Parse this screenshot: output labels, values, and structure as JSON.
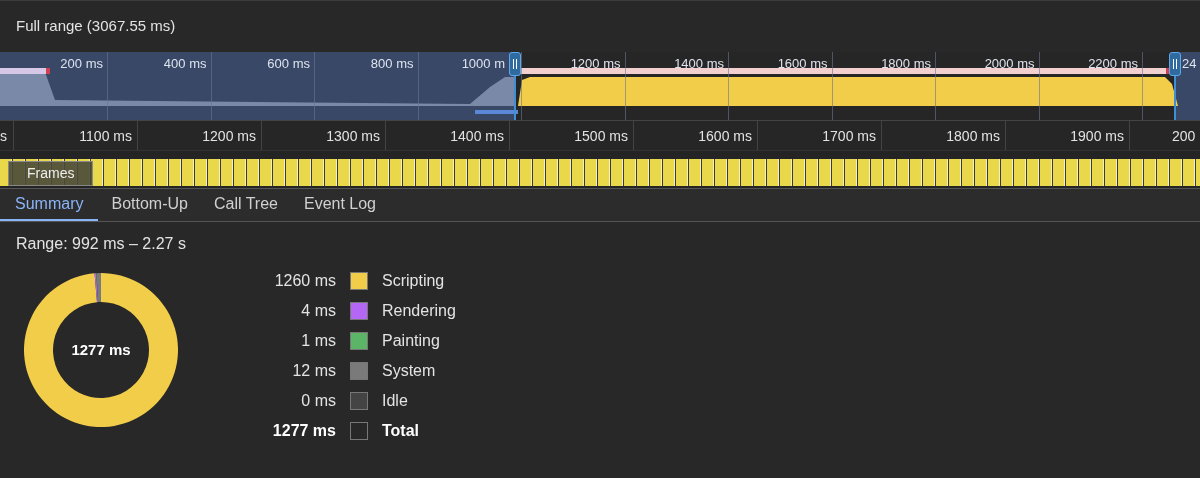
{
  "header": {
    "title": "Full range (3067.55 ms)"
  },
  "overview": {
    "ticks": [
      "200 ms",
      "400 ms",
      "600 ms",
      "800 ms",
      "1000 m",
      "1200 ms",
      "1400 ms",
      "1600 ms",
      "1800 ms",
      "2000 ms",
      "2200 ms",
      "24"
    ]
  },
  "ruler": {
    "ticks": [
      "s",
      "1100 ms",
      "1200 ms",
      "1300 ms",
      "1400 ms",
      "1500 ms",
      "1600 ms",
      "1700 ms",
      "1800 ms",
      "1900 ms",
      "200"
    ]
  },
  "frames": {
    "label": "Frames"
  },
  "tabs": [
    {
      "label": "Summary",
      "selected": true
    },
    {
      "label": "Bottom-Up",
      "selected": false
    },
    {
      "label": "Call Tree",
      "selected": false
    },
    {
      "label": "Event Log",
      "selected": false
    }
  ],
  "summary": {
    "range": "Range: 992 ms – 2.27 s",
    "center_label": "1277 ms",
    "chart_data": {
      "type": "donut",
      "categories": [
        "Scripting",
        "Rendering",
        "Painting",
        "System",
        "Idle"
      ],
      "values": [
        98.67,
        0.31,
        0.08,
        0.94,
        0
      ]
    },
    "legend": [
      {
        "kind": "category",
        "value": "1260 ms",
        "color": "#f2cd4a"
      },
      {
        "kind": "category",
        "value": "4 ms",
        "color": "#b467f5"
      },
      {
        "kind": "category",
        "value": "1 ms",
        "color": "#5cb567"
      },
      {
        "kind": "category",
        "value": "12 ms",
        "color": "#7a7a7a"
      },
      {
        "kind": "category",
        "value": "0 ms",
        "color": "#444444"
      },
      {
        "kind": "total",
        "value": "1277 ms",
        "label": "Total"
      }
    ]
  }
}
